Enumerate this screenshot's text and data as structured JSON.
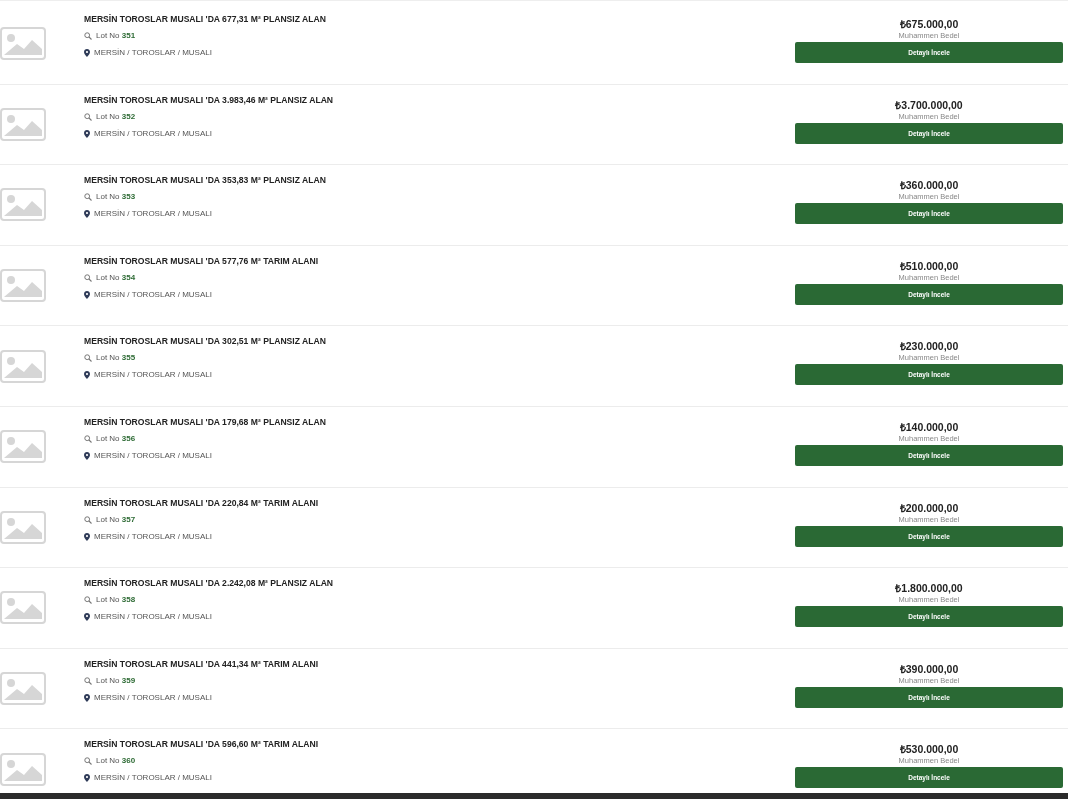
{
  "listings": [
    {
      "title": "MERSİN TOROSLAR MUSALI 'DA 677,31 M² PLANSIZ ALAN",
      "lot_label": "Lot No",
      "lot_number": "351",
      "location": "MERSİN / TOROSLAR / MUSALI",
      "price": "₺675.000,00",
      "price_label": "Muhammen Bedel",
      "button": "Detaylı İncele"
    },
    {
      "title": "MERSİN TOROSLAR MUSALI 'DA 3.983,46 M² PLANSIZ ALAN",
      "lot_label": "Lot No",
      "lot_number": "352",
      "location": "MERSİN / TOROSLAR / MUSALI",
      "price": "₺3.700.000,00",
      "price_label": "Muhammen Bedel",
      "button": "Detaylı İncele"
    },
    {
      "title": "MERSİN TOROSLAR MUSALI 'DA 353,83 M² PLANSIZ ALAN",
      "lot_label": "Lot No",
      "lot_number": "353",
      "location": "MERSİN / TOROSLAR / MUSALI",
      "price": "₺360.000,00",
      "price_label": "Muhammen Bedel",
      "button": "Detaylı İncele"
    },
    {
      "title": "MERSİN TOROSLAR MUSALI 'DA 577,76 M² TARIM ALANI",
      "lot_label": "Lot No",
      "lot_number": "354",
      "location": "MERSİN / TOROSLAR / MUSALI",
      "price": "₺510.000,00",
      "price_label": "Muhammen Bedel",
      "button": "Detaylı İncele"
    },
    {
      "title": "MERSİN TOROSLAR MUSALI 'DA 302,51 M² PLANSIZ ALAN",
      "lot_label": "Lot No",
      "lot_number": "355",
      "location": "MERSİN / TOROSLAR / MUSALI",
      "price": "₺230.000,00",
      "price_label": "Muhammen Bedel",
      "button": "Detaylı İncele"
    },
    {
      "title": "MERSİN TOROSLAR MUSALI 'DA 179,68 M² PLANSIZ ALAN",
      "lot_label": "Lot No",
      "lot_number": "356",
      "location": "MERSİN / TOROSLAR / MUSALI",
      "price": "₺140.000,00",
      "price_label": "Muhammen Bedel",
      "button": "Detaylı İncele"
    },
    {
      "title": "MERSİN TOROSLAR MUSALI 'DA 220,84 M² TARIM ALANI",
      "lot_label": "Lot No",
      "lot_number": "357",
      "location": "MERSİN / TOROSLAR / MUSALI",
      "price": "₺200.000,00",
      "price_label": "Muhammen Bedel",
      "button": "Detaylı İncele"
    },
    {
      "title": "MERSİN TOROSLAR MUSALI 'DA 2.242,08 M² PLANSIZ ALAN",
      "lot_label": "Lot No",
      "lot_number": "358",
      "location": "MERSİN / TOROSLAR / MUSALI",
      "price": "₺1.800.000,00",
      "price_label": "Muhammen Bedel",
      "button": "Detaylı İncele"
    },
    {
      "title": "MERSİN TOROSLAR MUSALI 'DA 441,34 M² TARIM ALANI",
      "lot_label": "Lot No",
      "lot_number": "359",
      "location": "MERSİN / TOROSLAR / MUSALI",
      "price": "₺390.000,00",
      "price_label": "Muhammen Bedel",
      "button": "Detaylı İncele"
    },
    {
      "title": "MERSİN TOROSLAR MUSALI 'DA 596,60 M² TARIM ALANI",
      "lot_label": "Lot No",
      "lot_number": "360",
      "location": "MERSİN / TOROSLAR / MUSALI",
      "price": "₺530.000,00",
      "price_label": "Muhammen Bedel",
      "button": "Detaylı İncele"
    }
  ]
}
